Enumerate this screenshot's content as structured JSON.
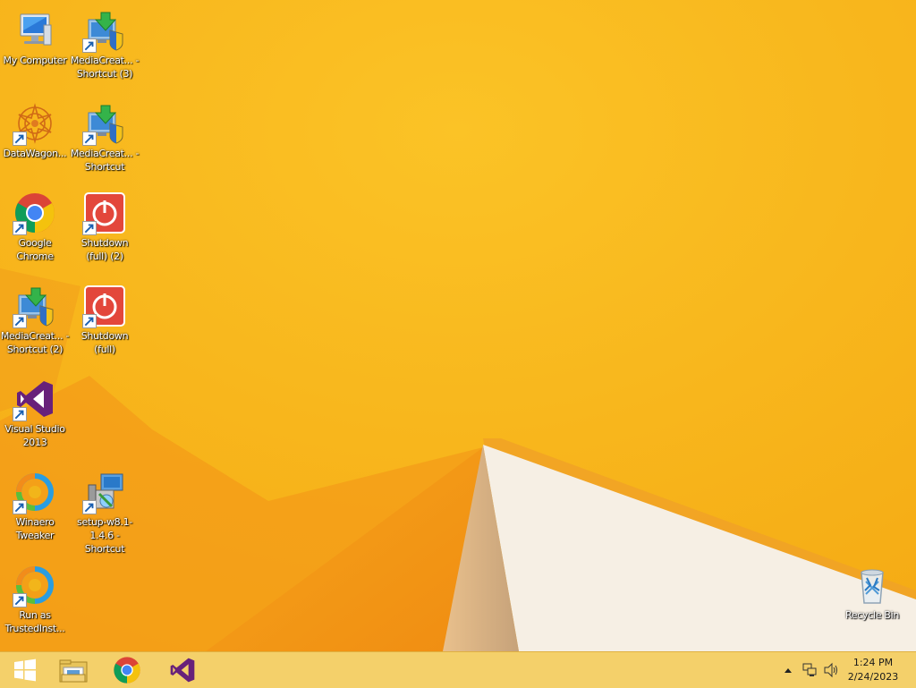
{
  "desktop": {
    "icons": [
      {
        "id": "my-computer",
        "label": "My Computer",
        "icon": "computer-icon"
      },
      {
        "id": "mediacreation-3",
        "label": "MediaCreat... - Shortcut (3)",
        "icon": "media-creation-tool-icon"
      },
      {
        "id": "datawagon",
        "label": "DataWagon...",
        "icon": "datawagon-icon"
      },
      {
        "id": "mediacreation-1",
        "label": "MediaCreat... - Shortcut",
        "icon": "media-creation-tool-icon"
      },
      {
        "id": "chrome",
        "label": "Google Chrome",
        "icon": "chrome-icon"
      },
      {
        "id": "shutdown-2",
        "label": "Shutdown (full) (2)",
        "icon": "shutdown-icon"
      },
      {
        "id": "mediacreation-2",
        "label": "MediaCreat... - Shortcut (2)",
        "icon": "media-creation-tool-icon"
      },
      {
        "id": "shutdown-1",
        "label": "Shutdown (full)",
        "icon": "shutdown-icon"
      },
      {
        "id": "visual-studio",
        "label": "Visual Studio 2013",
        "icon": "visual-studio-icon"
      },
      {
        "id": "winaero",
        "label": "Winaero Tweaker",
        "icon": "winaero-tweaker-icon"
      },
      {
        "id": "setup-w81",
        "label": "setup-w8.1-1.4.6 - Shortcut",
        "icon": "setup-installer-icon"
      },
      {
        "id": "trustedinstaller",
        "label": "Run as TrustedInst...",
        "icon": "winaero-tweaker-icon"
      },
      {
        "id": "recycle-bin",
        "label": "Recycle Bin",
        "icon": "recycle-bin-icon"
      }
    ]
  },
  "taskbar": {
    "start": "windows-logo-icon",
    "pinned": [
      "file-explorer-icon",
      "chrome-icon",
      "visual-studio-icon"
    ],
    "tray": {
      "overflow": "show-hidden-icons-icon",
      "network": "network-icon",
      "volume": "volume-icon",
      "time": "1:24 PM",
      "date": "2/24/2023"
    }
  },
  "colors": {
    "wallpaper": "#f7b21a",
    "taskbar": "#f4d06a"
  }
}
